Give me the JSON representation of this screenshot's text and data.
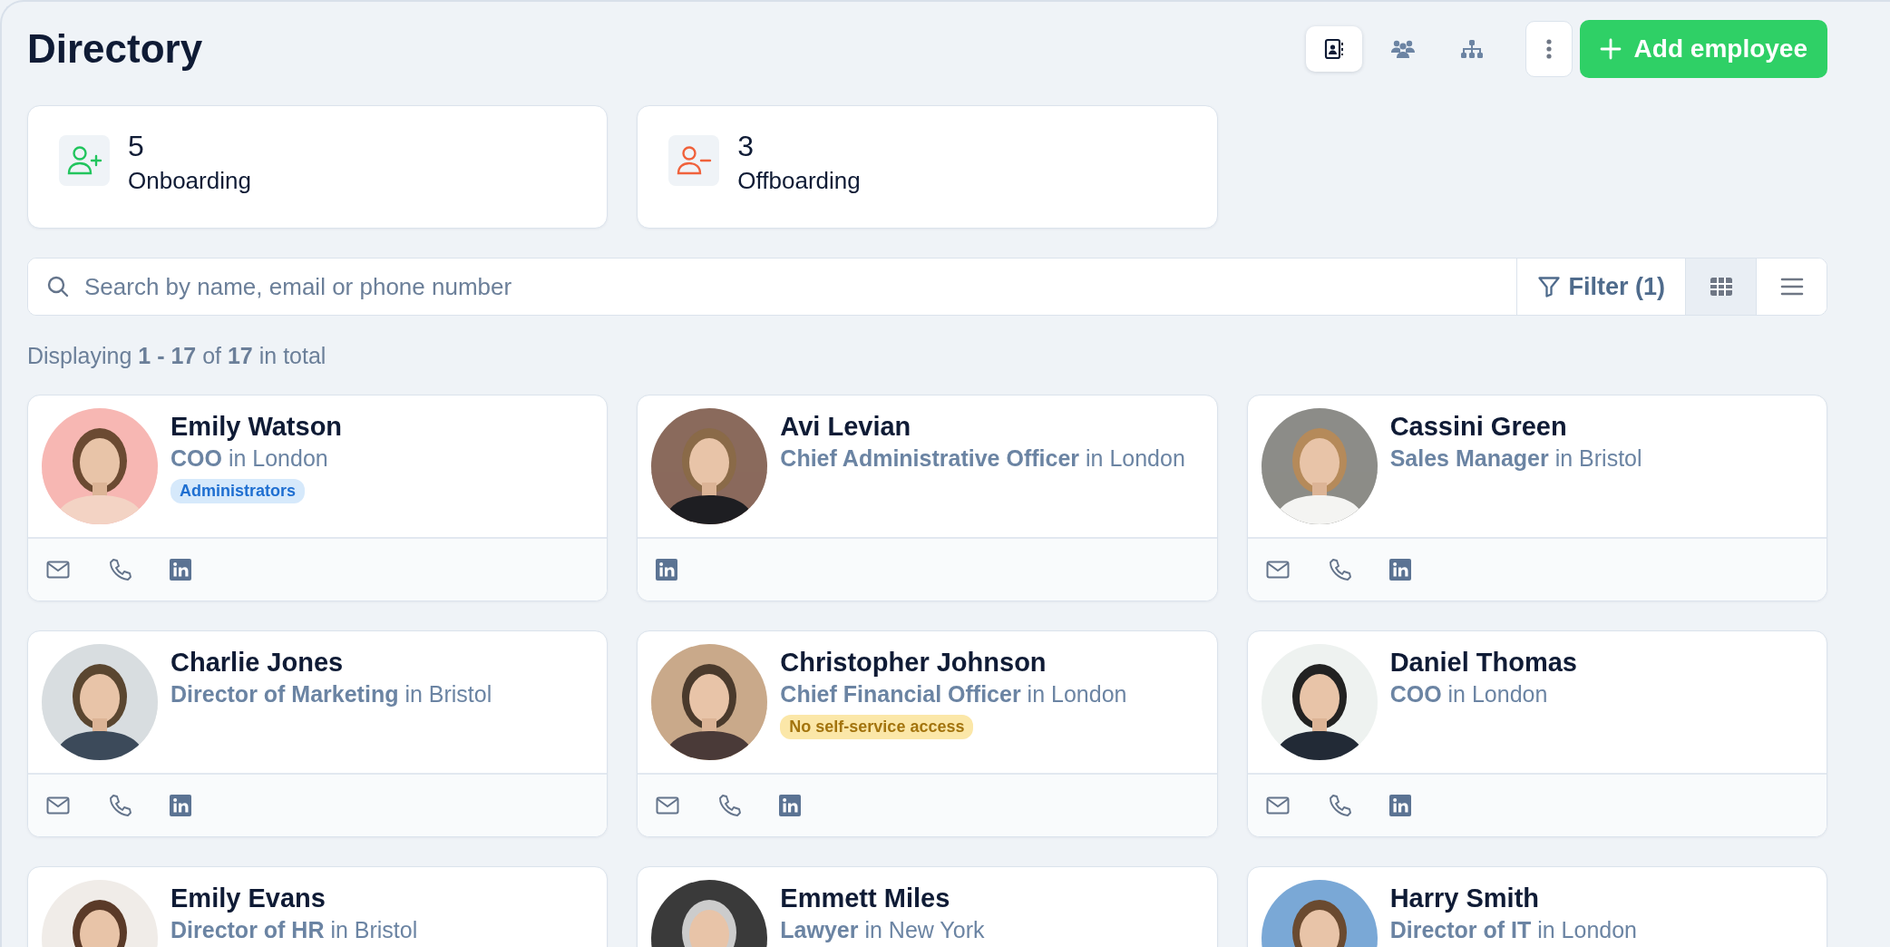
{
  "header": {
    "title": "Directory",
    "view_modes": [
      {
        "kind": "directory",
        "selected": true
      },
      {
        "kind": "team",
        "selected": false
      },
      {
        "kind": "org",
        "selected": false
      }
    ],
    "add_button": "Add employee"
  },
  "stats": [
    {
      "kind": "onboarding",
      "count": "5",
      "label": "Onboarding"
    },
    {
      "kind": "offboarding",
      "count": "3",
      "label": "Offboarding"
    }
  ],
  "search": {
    "placeholder": "Search by name, email or phone number",
    "filter": "Filter (1)",
    "layouts": [
      {
        "kind": "grid",
        "selected": true
      },
      {
        "kind": "list",
        "selected": false
      }
    ]
  },
  "summary": "Displaying **1 - 17** of **17** in total",
  "employees": [
    {
      "name": "Emily Watson",
      "subtitle": "**COO** in London",
      "badge": {
        "kind": "role",
        "text": "Administrators"
      },
      "contacts": [
        {
          "kind": "email"
        },
        {
          "kind": "phone"
        },
        {
          "kind": "linkedin"
        }
      ],
      "photo": {
        "kind": "picture"
      }
    },
    {
      "name": "Avi Levian",
      "subtitle": "**Chief Administrative Officer** in London",
      "contacts": [
        {
          "kind": "linkedin"
        }
      ],
      "photo": {
        "kind": "picture"
      }
    },
    {
      "name": "Cassini Green",
      "subtitle": "**Sales Manager** in Bristol",
      "contacts": [
        {
          "kind": "email"
        },
        {
          "kind": "phone"
        },
        {
          "kind": "linkedin"
        }
      ],
      "photo": {
        "kind": "picture"
      }
    },
    {
      "name": "Charlie Jones",
      "subtitle": "**Director of Marketing** in Bristol",
      "contacts": [
        {
          "kind": "email"
        },
        {
          "kind": "phone"
        },
        {
          "kind": "linkedin"
        }
      ],
      "photo": {
        "kind": "picture"
      }
    },
    {
      "name": "Christopher Johnson",
      "subtitle": "**Chief Financial Officer** in London",
      "badge": {
        "kind": "warning",
        "text": "No self-service access"
      },
      "contacts": [
        {
          "kind": "email"
        },
        {
          "kind": "phone"
        },
        {
          "kind": "linkedin"
        }
      ],
      "photo": {
        "kind": "picture"
      }
    },
    {
      "name": "Daniel Thomas",
      "subtitle": "**COO** in London",
      "contacts": [
        {
          "kind": "email"
        },
        {
          "kind": "phone"
        },
        {
          "kind": "linkedin"
        }
      ],
      "photo": {
        "kind": "picture"
      }
    },
    {
      "name": "Emily Evans",
      "subtitle": "**Director of HR** in Bristol",
      "photo": {
        "kind": "picture"
      }
    },
    {
      "name": "Emmett Miles",
      "subtitle": "**Lawyer** in New York",
      "photo": {
        "kind": "picture"
      }
    },
    {
      "name": "Harry Smith",
      "subtitle": "**Director of IT** in London",
      "photo": {
        "kind": "picture"
      }
    }
  ]
}
